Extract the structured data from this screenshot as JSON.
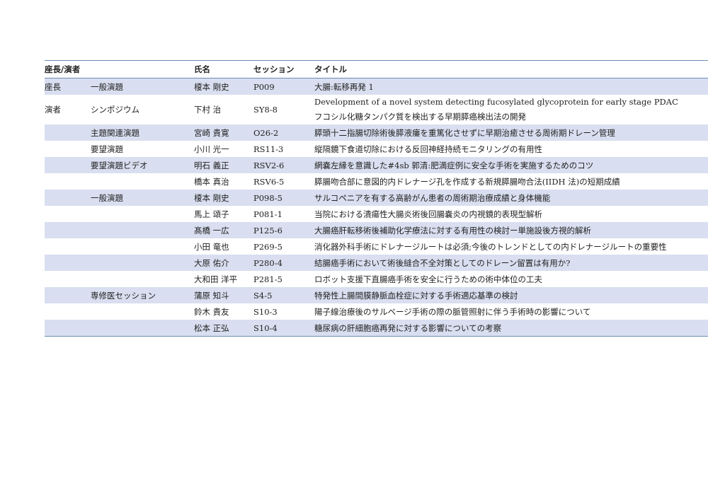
{
  "header": {
    "role": "座長/演者",
    "name": "氏名",
    "session": "セッション",
    "title": "タイトル"
  },
  "rows": [
    {
      "role": "座長",
      "category": "一般演題",
      "name": "榎本 剛史",
      "session": "P009",
      "title": "大腸:転移再発 1"
    },
    {
      "role": "演者",
      "category": "シンポジウム",
      "name": "下村 治",
      "session": "SY8-8",
      "title": "Development of a novel system detecting fucosylated glycoprotein for early stage PDAC",
      "title2": "フコシル化糖タンパク質を検出する早期膵癌検出法の開発"
    },
    {
      "role": "",
      "category": "主題関連演題",
      "name": "宮崎 貴寛",
      "session": "O26-2",
      "title": "膵頭十二指腸切除術後膵液瘻を重篤化させずに早期治癒させる周術期ドレーン管理"
    },
    {
      "role": "",
      "category": "要望演題",
      "name": "小川 光一",
      "session": "RS11-3",
      "title": "縦隔鏡下食道切除における反回神経持続モニタリングの有用性"
    },
    {
      "role": "",
      "category": "要望演題ビデオ",
      "name": "明石 義正",
      "session": "RSV2-6",
      "title": "網嚢左縁を意識した#4sb 郭清:肥満症例に安全な手術を実施するためのコツ"
    },
    {
      "role": "",
      "category": "",
      "name": "橋本 真治",
      "session": "RSV6-5",
      "title": "膵腸吻合部に意図的内ドレナージ孔を作成する新規膵腸吻合法(IIDH 法)の短期成績"
    },
    {
      "role": "",
      "category": "一般演題",
      "name": "榎本 剛史",
      "session": "P098-5",
      "title": "サルコペニアを有する高齢がん患者の周術期治療成績と身体機能"
    },
    {
      "role": "",
      "category": "",
      "name": "馬上 頌子",
      "session": "P081-1",
      "title": "当院における潰瘍性大腸炎術後回腸嚢炎の内視鏡的表現型解析"
    },
    {
      "role": "",
      "category": "",
      "name": "髙橋 一広",
      "session": "P125-6",
      "title": "大腸癌肝転移術後補助化学療法に対する有用性の検討ー単施設後方視的解析"
    },
    {
      "role": "",
      "category": "",
      "name": "小田 竜也",
      "session": "P269-5",
      "title": "消化器外科手術にドレナージルートは必須;今後のトレンドとしての内ドレナージルートの重要性"
    },
    {
      "role": "",
      "category": "",
      "name": "大原 佑介",
      "session": "P280-4",
      "title": "結腸癌手術において術後縫合不全対策としてのドレーン留置は有用か?"
    },
    {
      "role": "",
      "category": "",
      "name": "大和田 洋平",
      "session": "P281-5",
      "title": "ロボット支援下直腸癌手術を安全に行うための術中体位の工夫"
    },
    {
      "role": "",
      "category": "専修医セッション",
      "name": "蒲原 知斗",
      "session": "S4-5",
      "title": "特発性上腸間膜静脈血栓症に対する手術適応基準の検討"
    },
    {
      "role": "",
      "category": "",
      "name": "鈴木 貴友",
      "session": "S10-3",
      "title": "陽子線治療後のサルベージ手術の際の脈管照射に伴う手術時の影響について"
    },
    {
      "role": "",
      "category": "",
      "name": "松本 正弘",
      "session": "S10-4",
      "title": "糖尿病の肝細胞癌再発に対する影響についての考察"
    }
  ]
}
